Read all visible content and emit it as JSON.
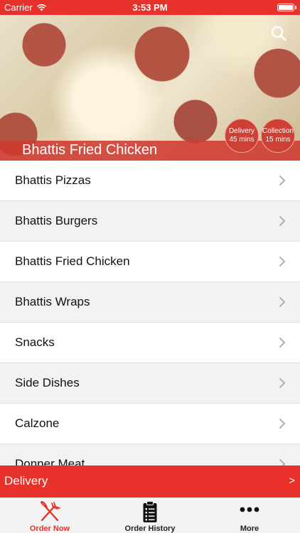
{
  "status_bar": {
    "carrier": "Carrier",
    "time": "3:53 PM"
  },
  "header": {
    "restaurant_name": "Bhattis Fried Chicken",
    "delivery_badge": {
      "label": "Delivery",
      "time": "45 mins"
    },
    "collection_badge": {
      "label": "Collection",
      "time": "15 mins"
    }
  },
  "menu": {
    "items": [
      {
        "label": "Bhattis Pizzas"
      },
      {
        "label": "Bhattis Burgers"
      },
      {
        "label": "Bhattis Fried Chicken"
      },
      {
        "label": "Bhattis Wraps"
      },
      {
        "label": "Snacks"
      },
      {
        "label": "Side Dishes"
      },
      {
        "label": "Calzone"
      },
      {
        "label": "Donner Meat"
      }
    ]
  },
  "order_mode": {
    "label": "Delivery",
    "arrow": ">"
  },
  "tabs": [
    {
      "label": "Order Now",
      "icon": "fork-knife-icon",
      "active": true
    },
    {
      "label": "Order History",
      "icon": "clipboard-list-icon",
      "active": false
    },
    {
      "label": "More",
      "icon": "more-dots-icon",
      "active": false
    }
  ],
  "colors": {
    "accent": "#e8312a",
    "shaded_row": "#f2f2f4",
    "tab_bar": "#f3f3f3"
  }
}
